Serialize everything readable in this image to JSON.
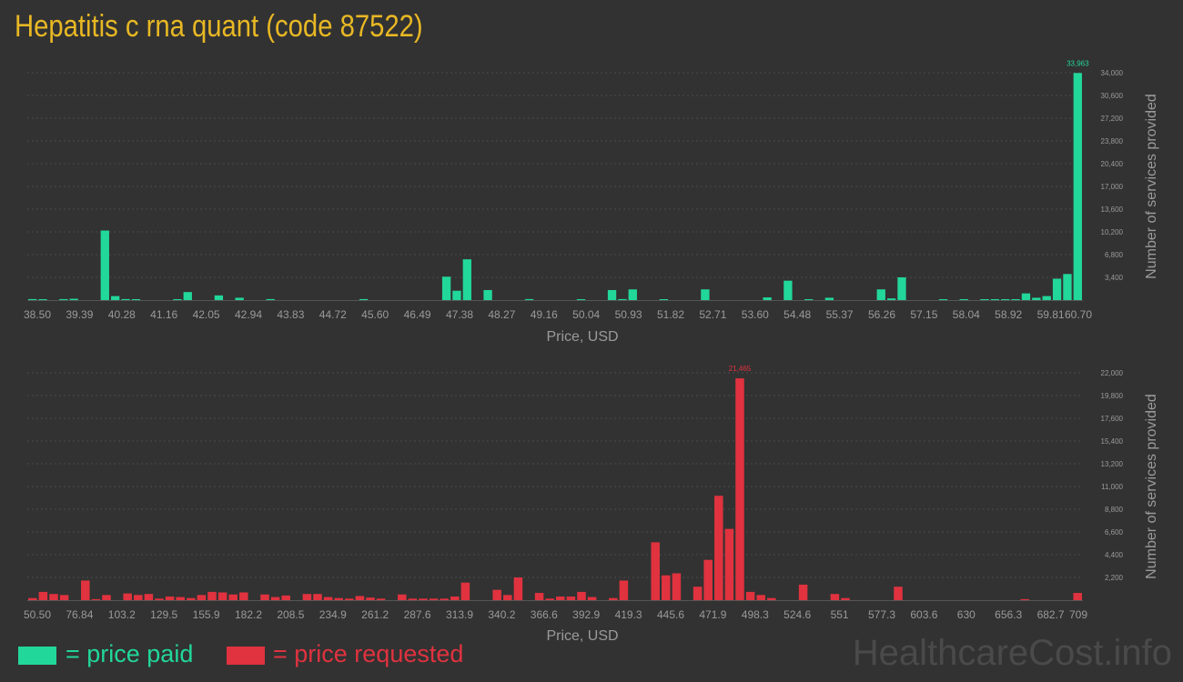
{
  "title": "Hepatitis c rna quant (code 87522)",
  "legend": {
    "paid": "= price paid",
    "requested": "= price requested"
  },
  "watermark": "HealthcareCost.info",
  "colors": {
    "title": "#e8b824",
    "paid": "#22d79a",
    "requested": "#e0323f",
    "background": "#323232",
    "text": "#9a9a9a",
    "grid": "#4a4a4a"
  },
  "chart_data": [
    {
      "type": "bar",
      "series_name": "price paid",
      "xlabel": "Price, USD",
      "ylabel": "Number of services provided",
      "x_tick_labels": [
        "38.50",
        "39.39",
        "40.28",
        "41.16",
        "42.05",
        "42.94",
        "43.83",
        "44.72",
        "45.60",
        "46.49",
        "47.38",
        "48.27",
        "49.16",
        "50.04",
        "50.93",
        "51.82",
        "52.71",
        "53.60",
        "54.48",
        "55.37",
        "56.26",
        "57.15",
        "58.04",
        "58.92",
        "59.81",
        "60.70"
      ],
      "xlim": [
        38.5,
        60.7
      ],
      "y_ticks": [
        "3,400",
        "6,800",
        "10,200",
        "13,600",
        "17,000",
        "20,400",
        "23,800",
        "27,200",
        "30,600",
        "34,000"
      ],
      "ylim": [
        0,
        34000
      ],
      "peak_label": "33,963",
      "values": [
        150,
        120,
        0,
        150,
        200,
        0,
        0,
        10400,
        600,
        150,
        100,
        0,
        0,
        0,
        80,
        1200,
        0,
        0,
        700,
        0,
        350,
        0,
        0,
        150,
        0,
        0,
        0,
        0,
        0,
        0,
        0,
        0,
        150,
        0,
        0,
        0,
        0,
        0,
        0,
        0,
        3500,
        1400,
        6100,
        0,
        1500,
        0,
        0,
        0,
        150,
        0,
        0,
        0,
        0,
        80,
        0,
        0,
        1500,
        150,
        1600,
        0,
        0,
        80,
        0,
        0,
        0,
        1600,
        0,
        0,
        0,
        0,
        0,
        400,
        0,
        2900,
        0,
        80,
        0,
        350,
        0,
        0,
        0,
        0,
        1600,
        250,
        3400,
        0,
        0,
        0,
        80,
        0,
        80,
        0,
        80,
        120,
        80,
        120,
        1000,
        350,
        600,
        3200,
        3900,
        33963
      ]
    },
    {
      "type": "bar",
      "series_name": "price requested",
      "xlabel": "Price, USD",
      "ylabel": "Number of services provided",
      "x_tick_labels": [
        "50.50",
        "76.84",
        "103.2",
        "129.5",
        "155.9",
        "182.2",
        "208.5",
        "234.9",
        "261.2",
        "287.6",
        "313.9",
        "340.2",
        "366.6",
        "392.9",
        "419.3",
        "445.6",
        "471.9",
        "498.3",
        "524.6",
        "551",
        "577.3",
        "603.6",
        "630",
        "656.3",
        "682.7",
        "709"
      ],
      "xlim": [
        50.5,
        709
      ],
      "y_ticks": [
        "2,200",
        "4,400",
        "6,600",
        "8,800",
        "11,000",
        "13,200",
        "15,400",
        "17,600",
        "19,800",
        "22,000"
      ],
      "ylim": [
        0,
        22000
      ],
      "peak_label": "21,465",
      "values": [
        200,
        800,
        600,
        500,
        0,
        1900,
        100,
        500,
        0,
        650,
        500,
        600,
        150,
        350,
        300,
        200,
        500,
        800,
        750,
        550,
        750,
        0,
        550,
        300,
        450,
        0,
        600,
        600,
        300,
        200,
        150,
        400,
        250,
        150,
        0,
        550,
        150,
        150,
        150,
        150,
        350,
        1700,
        0,
        0,
        1000,
        500,
        2200,
        0,
        700,
        150,
        350,
        350,
        800,
        300,
        0,
        200,
        1900,
        0,
        0,
        5600,
        2400,
        2600,
        0,
        1300,
        3900,
        10100,
        6900,
        21465,
        800,
        500,
        200,
        0,
        0,
        1500,
        0,
        0,
        600,
        200,
        0,
        0,
        0,
        0,
        1300,
        0,
        0,
        0,
        0,
        0,
        0,
        0,
        0,
        0,
        0,
        0,
        100,
        0,
        0,
        0,
        0,
        700
      ]
    }
  ]
}
